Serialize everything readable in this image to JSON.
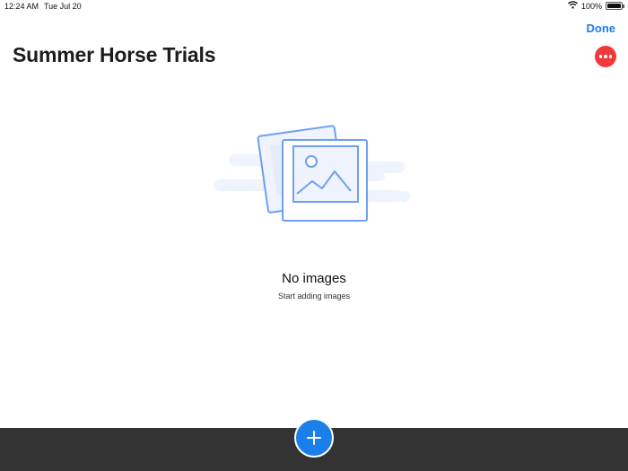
{
  "status_bar": {
    "time": "12:24 AM",
    "date": "Tue Jul 20",
    "battery": "100%",
    "icons": [
      "wifi-icon",
      "battery-icon"
    ]
  },
  "nav": {
    "done_label": "Done",
    "title": "Summer Horse Trials",
    "more_icon": "ellipsis-icon"
  },
  "empty_state": {
    "illustration": "photos-placeholder-icon",
    "title": "No images",
    "subtitle": "Start adding images"
  },
  "bottom_bar": {
    "add_icon": "plus-icon"
  },
  "colors": {
    "accent": "#1a7fe8",
    "more_button": "#f0393a",
    "bottom_bar": "#333333",
    "illustration_stroke": "#6f9ff0",
    "illustration_fill": "#eef3fd"
  }
}
